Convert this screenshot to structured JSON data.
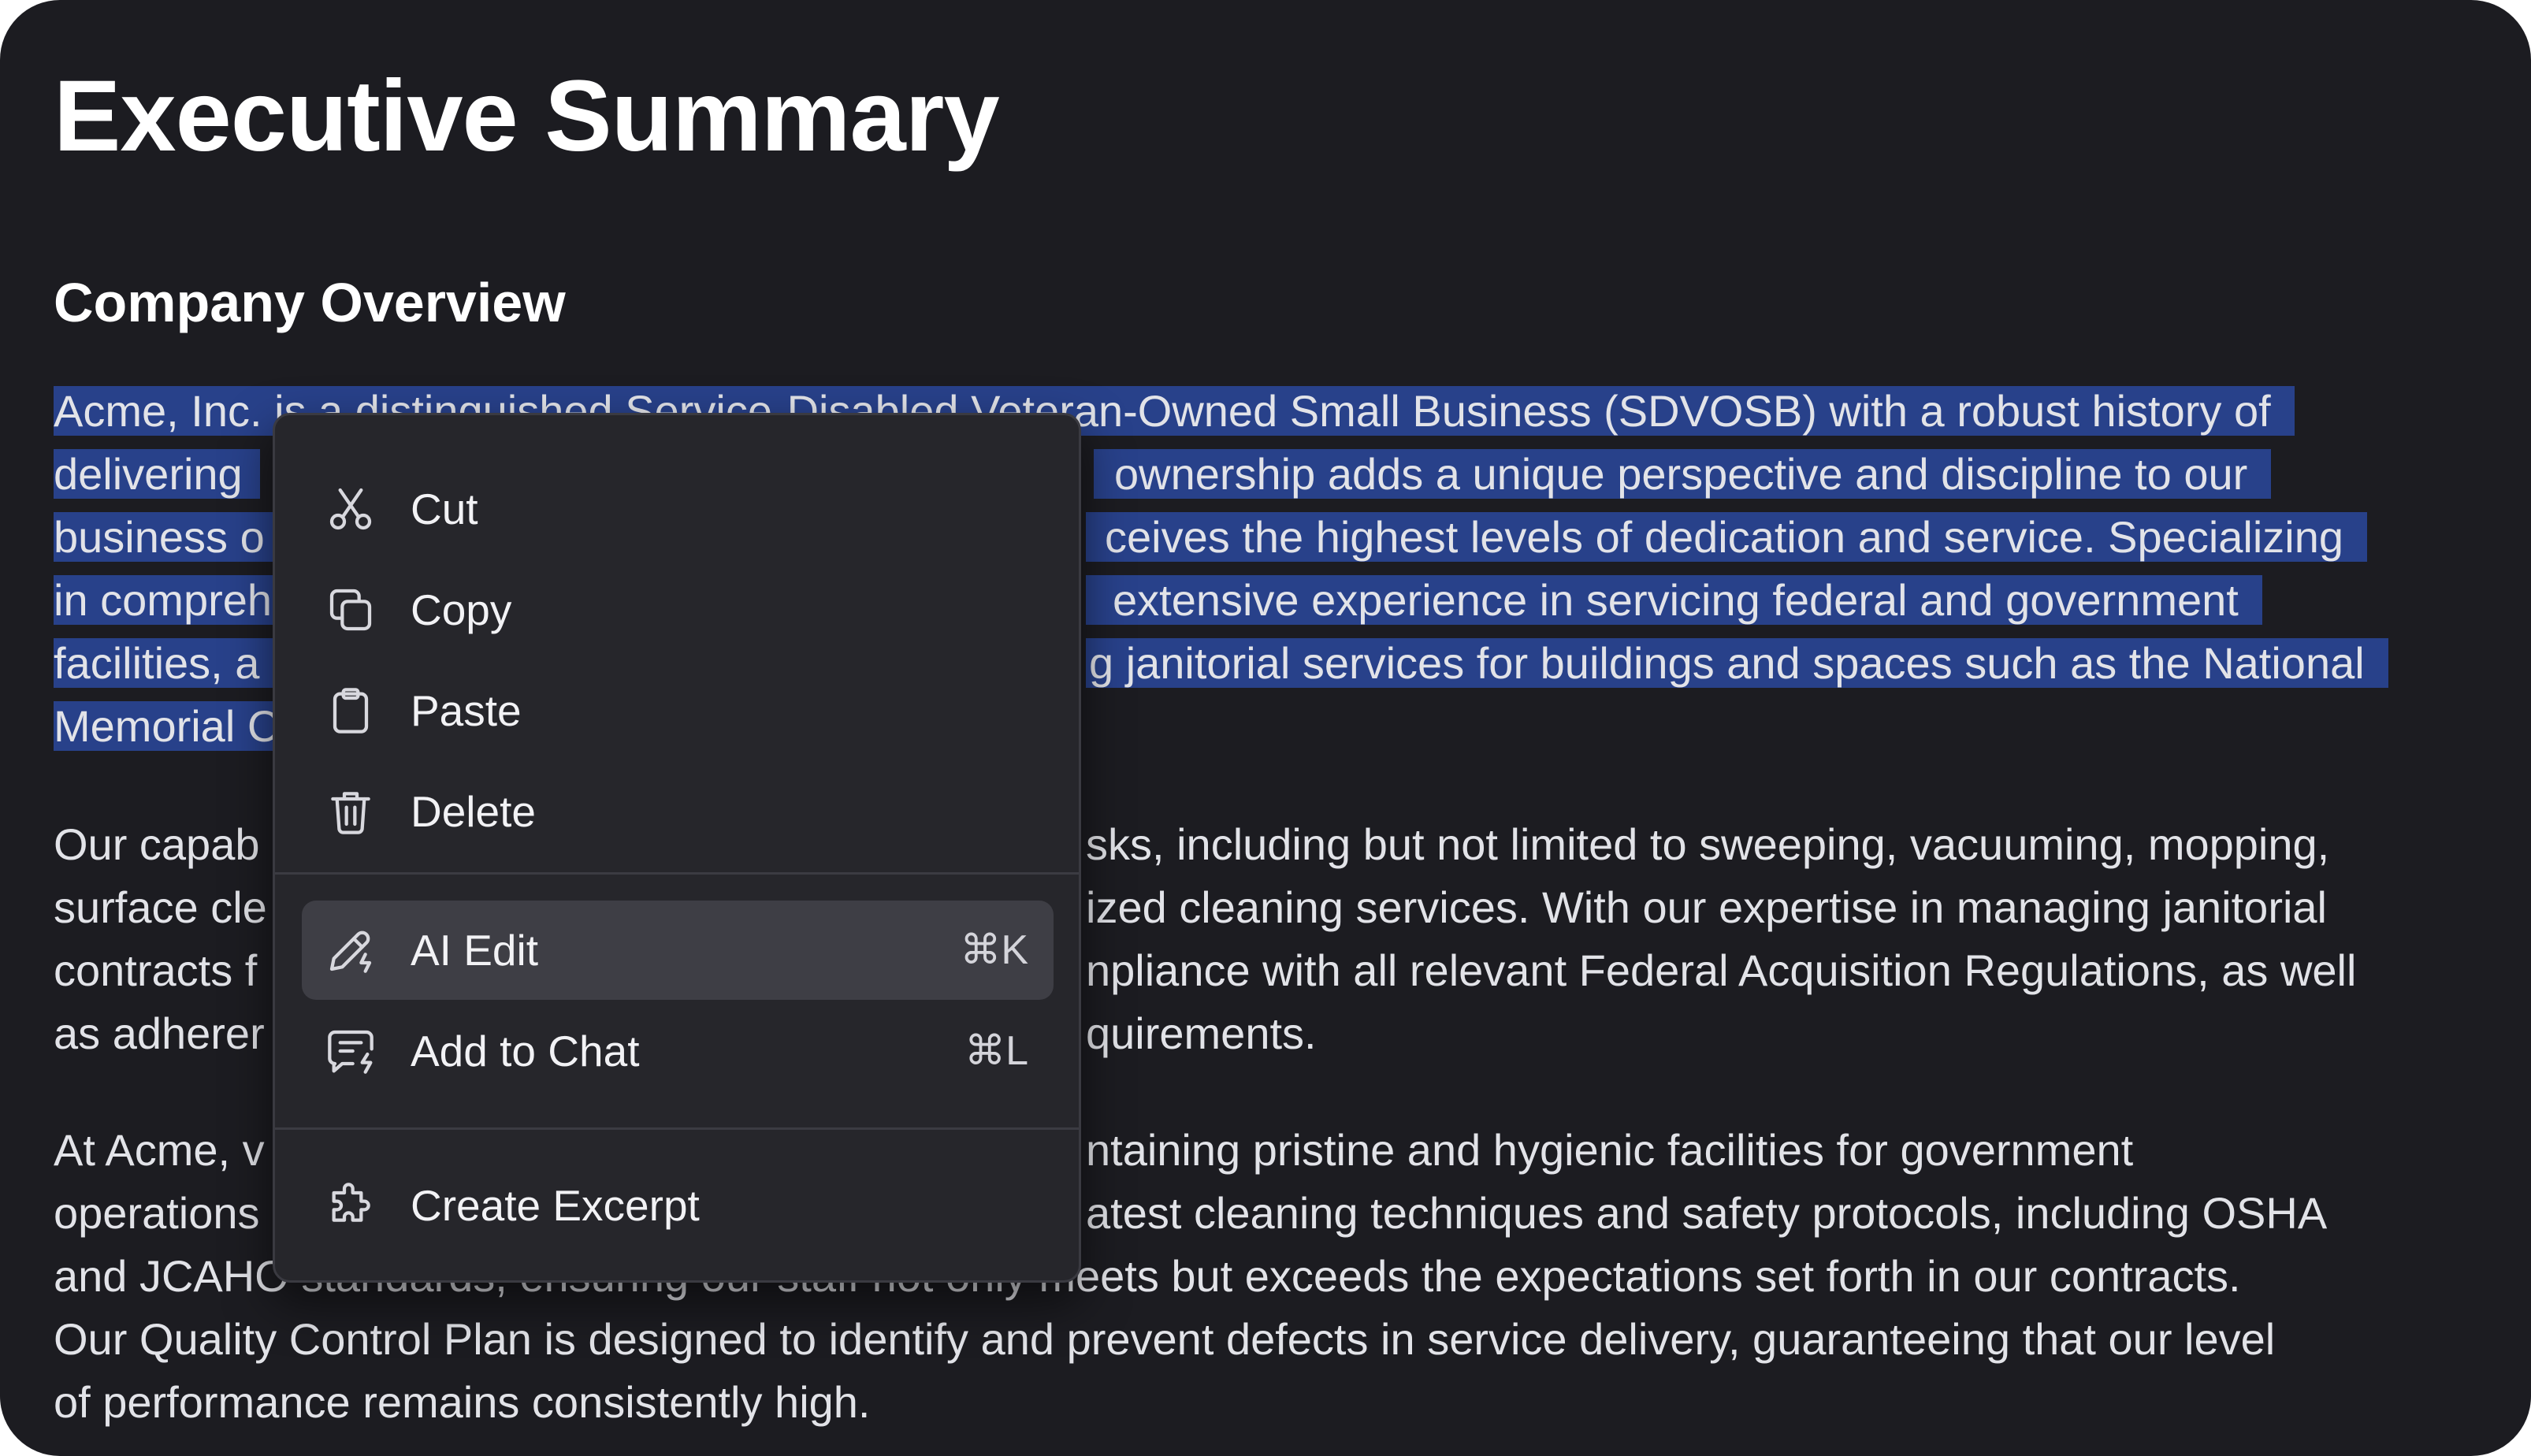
{
  "document": {
    "title": "Executive Summary",
    "section_heading": "Company Overview",
    "paragraph1_lines": [
      "Acme, Inc. is a distinguished Service-Disabled Veteran-Owned Small Business (SDVOSB) with a robust history of",
      "delivering",
      "business o",
      "in compreh",
      "facilities, a",
      "Memorial C"
    ],
    "paragraph1_right_fragments": [
      "",
      "ownership adds a unique perspective and discipline to our",
      "ceives the highest levels of dedication and service. Specializing",
      "extensive experience in servicing federal and government",
      "g janitorial services for buildings and spaces such as the National",
      ""
    ],
    "paragraph2_lines": [
      "Our capab",
      "surface cle",
      "contracts f",
      "as adherer"
    ],
    "paragraph2_right_fragments": [
      "sks, including but not limited to sweeping, vacuuming, mopping,",
      "ized cleaning services. With our expertise in managing janitorial",
      "npliance with all relevant Federal Acquisition Regulations, as well",
      "quirements."
    ],
    "paragraph3_lines": [
      "At Acme, v",
      "operations",
      "and JCAHO standards, ensuring our staff not only meets but exceeds the expectations set forth in our contracts.",
      "Our Quality Control Plan is designed to identify and prevent defects in service delivery, guaranteeing that our level",
      "of performance remains consistently high."
    ],
    "paragraph3_right_fragments": [
      "ntaining pristine and hygienic facilities for government",
      "atest cleaning techniques and safety protocols, including OSHA",
      "",
      "",
      ""
    ]
  },
  "context_menu": {
    "items": [
      {
        "label": "Cut",
        "icon": "scissors-icon",
        "shortcut": ""
      },
      {
        "label": "Copy",
        "icon": "copy-icon",
        "shortcut": ""
      },
      {
        "label": "Paste",
        "icon": "clipboard-icon",
        "shortcut": ""
      },
      {
        "label": "Delete",
        "icon": "trash-icon",
        "shortcut": ""
      },
      {
        "label": "AI Edit",
        "icon": "ai-pencil-icon",
        "shortcut": "⌘K"
      },
      {
        "label": "Add to Chat",
        "icon": "chat-bolt-icon",
        "shortcut": "⌘L"
      },
      {
        "label": "Create Excerpt",
        "icon": "puzzle-icon",
        "shortcut": ""
      }
    ],
    "highlighted_item": "AI Edit"
  },
  "colors": {
    "background": "#1c1c21",
    "selection": "#28418a",
    "menu_background": "#26262b",
    "menu_highlight": "#3e3e45"
  }
}
